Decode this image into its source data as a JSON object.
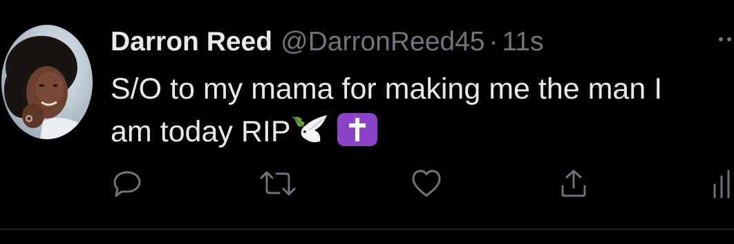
{
  "tweet": {
    "author_name": "Darron Reed",
    "author_handle": "@DarronReed45",
    "separator": "·",
    "timestamp": "11s",
    "text_line1": "S/O to my mama for making me the man I",
    "text_line2": "am today RIP"
  },
  "emojis": [
    "dove",
    "latin-cross"
  ],
  "actions": [
    "reply",
    "retweet",
    "like",
    "share",
    "analytics"
  ],
  "colors": {
    "background": "#000000",
    "primary_text": "#e7e9ea",
    "secondary_text": "#71767b",
    "cross_emoji_bg": "#8e44c9"
  }
}
